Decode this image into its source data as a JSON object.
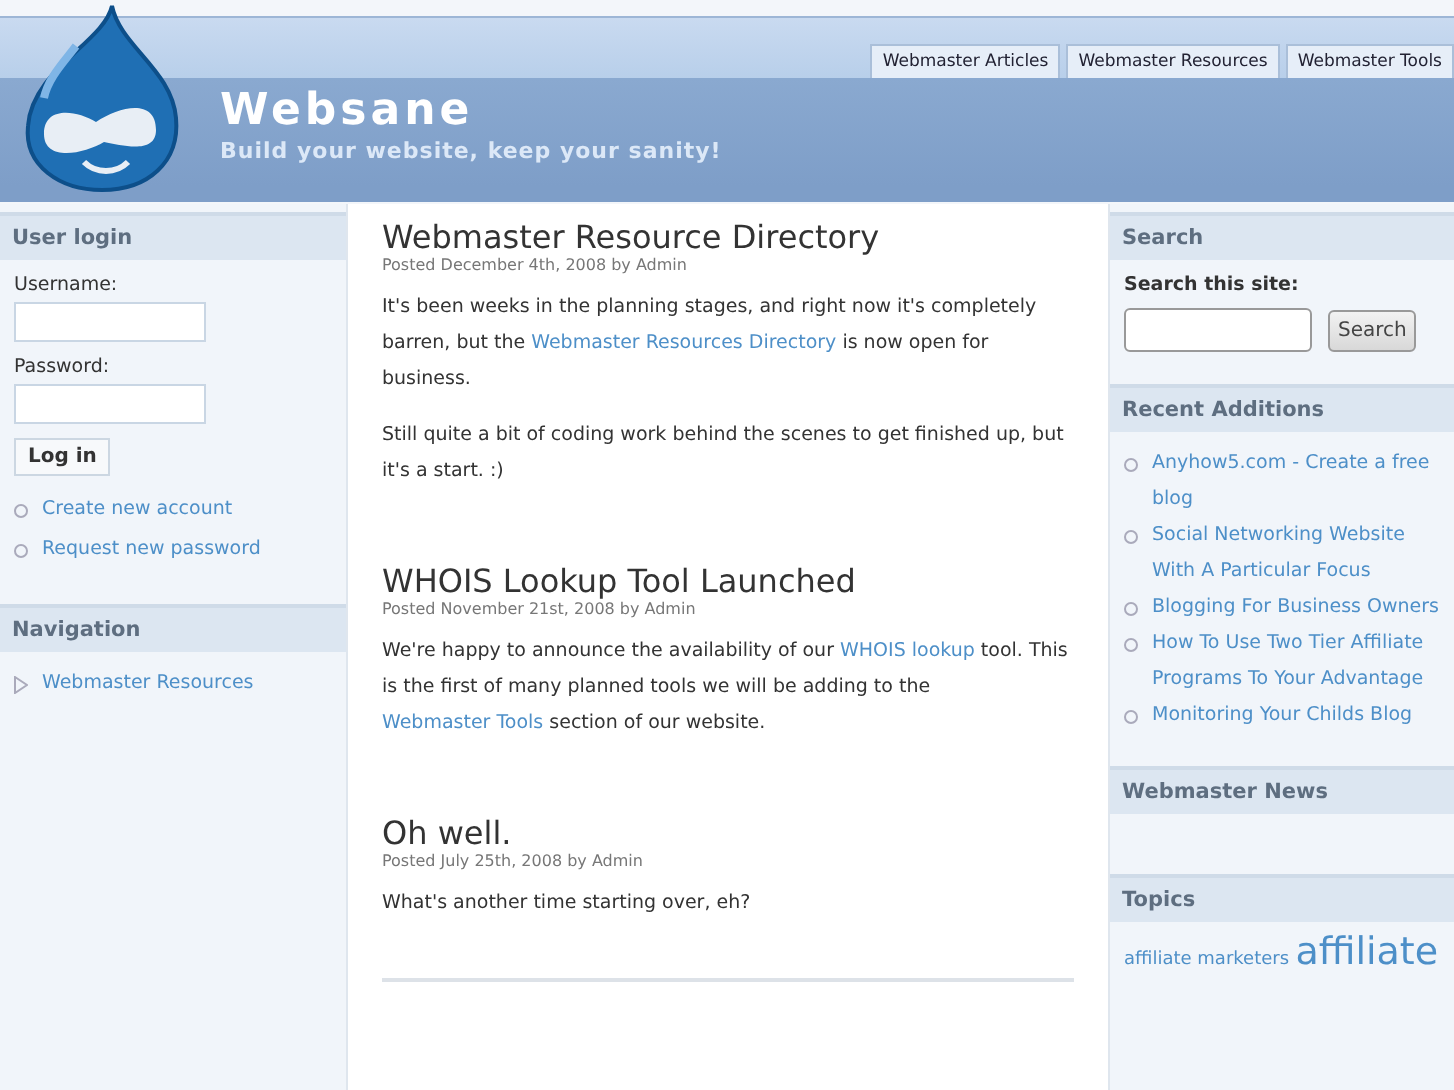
{
  "site": {
    "name": "Websane",
    "slogan": "Build your website, keep your sanity!"
  },
  "tabs": [
    {
      "label": "Webmaster Articles"
    },
    {
      "label": "Webmaster Resources"
    },
    {
      "label": "Webmaster Tools"
    }
  ],
  "user_login": {
    "title": "User login",
    "username_label": "Username:",
    "password_label": "Password:",
    "button": "Log in",
    "links": [
      "Create new account",
      "Request new password"
    ]
  },
  "navigation": {
    "title": "Navigation",
    "items": [
      "Webmaster Resources"
    ]
  },
  "posts": [
    {
      "title": "Webmaster Resource Directory",
      "meta": "Posted December 4th, 2008 by Admin",
      "paragraphs": [
        [
          {
            "kind": "text",
            "text": "It's been weeks in the planning stages, and right now it's completely barren, but the "
          },
          {
            "kind": "link",
            "text": "Webmaster Resources Directory"
          },
          {
            "kind": "text",
            "text": " is now open for business."
          }
        ],
        [
          {
            "kind": "text",
            "text": "Still quite a bit of coding work behind the scenes to get finished up, but it's a start. :)"
          }
        ]
      ]
    },
    {
      "title": "WHOIS Lookup Tool Launched",
      "meta": "Posted November 21st, 2008 by Admin",
      "paragraphs": [
        [
          {
            "kind": "text",
            "text": "We're happy to announce the availability of our "
          },
          {
            "kind": "link",
            "text": "WHOIS lookup"
          },
          {
            "kind": "text",
            "text": " tool. This is the first of many planned tools we will be adding to the "
          },
          {
            "kind": "link",
            "text": "Webmaster Tools"
          },
          {
            "kind": "text",
            "text": " section of our website."
          }
        ]
      ]
    },
    {
      "title": "Oh well.",
      "meta": "Posted July 25th, 2008 by Admin",
      "paragraphs": [
        [
          {
            "kind": "text",
            "text": "What's another time starting over, eh?"
          }
        ]
      ]
    }
  ],
  "search": {
    "title": "Search",
    "label": "Search this site:",
    "button": "Search"
  },
  "recent_additions": {
    "title": "Recent Additions",
    "items": [
      "Anyhow5.com - Create a free blog",
      "Social Networking Website With A Particular Focus",
      "Blogging For Business Owners",
      "How To Use Two Tier Affiliate Programs To Your Advantage",
      "Monitoring Your Childs Blog"
    ]
  },
  "webmaster_news": {
    "title": "Webmaster News"
  },
  "topics": {
    "title": "Topics",
    "tags": [
      {
        "text": "affiliate marketers",
        "kind": "small"
      },
      {
        "text": "affiliate",
        "kind": "large"
      }
    ]
  }
}
